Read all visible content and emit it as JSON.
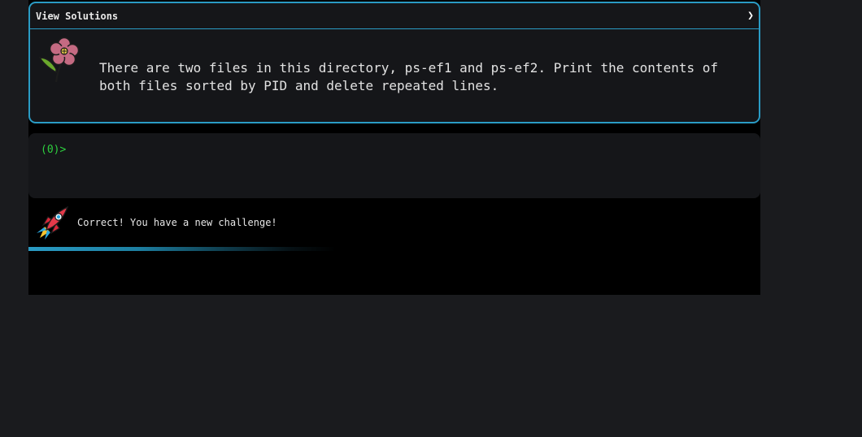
{
  "challenge": {
    "header_title": "View Solutions",
    "chevron_glyph": "❯",
    "description": "There are two files in this directory, ps-ef1 and ps-ef2. Print the contents of both files sorted by PID and delete repeated lines.",
    "icon": "flower-icon"
  },
  "terminal": {
    "prompt": "(0)>",
    "input_value": ""
  },
  "status": {
    "icon": "rocket-icon",
    "message": "Correct! You have a new challenge!"
  },
  "progress": {
    "fraction": 0.6
  },
  "colors": {
    "accent": "#2a9bc4",
    "prompt": "#2ed13f",
    "panel": "#151619",
    "background": "#1a1b1e"
  }
}
